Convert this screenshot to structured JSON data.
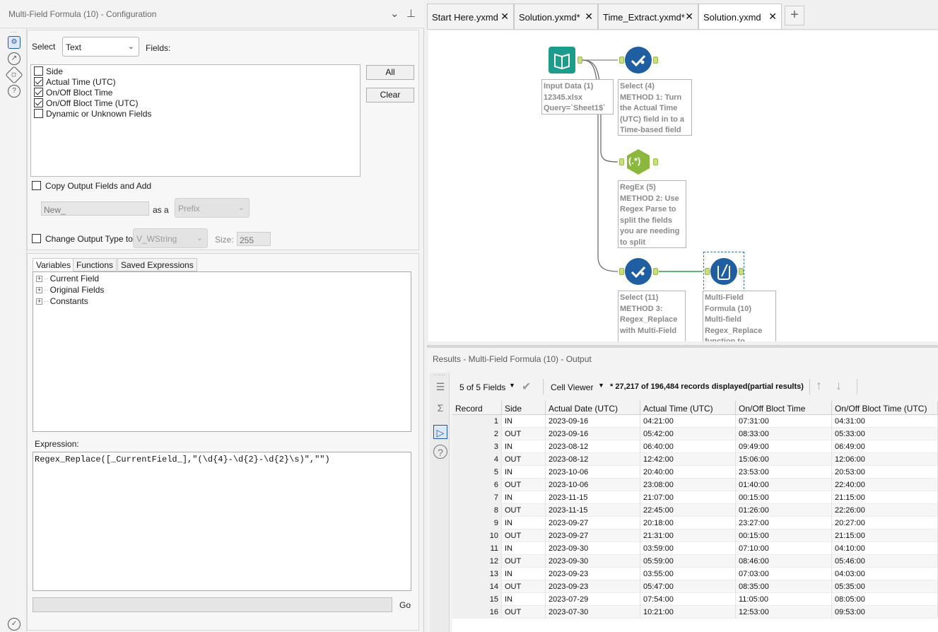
{
  "config_panel": {
    "title": "Multi-Field Formula (10) - Configuration",
    "select_label": "Select",
    "select_type_value": "Text",
    "fields_label": "Fields:",
    "fields": [
      {
        "label": "Side",
        "checked": false
      },
      {
        "label": "Actual Time (UTC)",
        "checked": true
      },
      {
        "label": "On/Off Bloct Time",
        "checked": true
      },
      {
        "label": "On/Off Bloct Time (UTC)",
        "checked": true
      },
      {
        "label": "Dynamic or Unknown Fields",
        "checked": false
      }
    ],
    "all_button": "All",
    "clear_button": "Clear",
    "copy_output_label": "Copy Output Fields and Add",
    "prefix_value": "New_",
    "as_a_label": "as a",
    "prefix_type": "Prefix",
    "change_output_label": "Change Output Type to",
    "output_type": "V_WString",
    "size_label": "Size:",
    "size_value": "255",
    "tabs": [
      "Variables",
      "Functions",
      "Saved Expressions"
    ],
    "variable_tree": [
      "Current Field",
      "Original Fields",
      "Constants"
    ],
    "expression_label": "Expression:",
    "expression": "Regex_Replace([_CurrentField_],\"(\\d{4}-\\d{2}-\\d{2}\\s)\",\"\")",
    "go_label": "Go"
  },
  "doc_tabs": [
    {
      "label": "Start Here.yxmd",
      "active": false
    },
    {
      "label": "Solution.yxmd*",
      "active": false
    },
    {
      "label": "Time_Extract.yxmd*",
      "active": false
    },
    {
      "label": "Solution.yxmd",
      "active": true
    }
  ],
  "workflow": {
    "input_node": "Input Data (1)\n12345.xlsx\nQuery=`Sheet1$`",
    "select4_node": "Select (4)\nMETHOD 1: Turn the Actual Time (UTC) field in to a Time-based field",
    "regex_node_icon": "(.*)",
    "regex_node": "RegEx (5)\nMETHOD 2: Use Regex Parse to split the fields you are needing to split",
    "select11_node": "Select (11)\nMETHOD 3: Regex_Replace with Multi-Field",
    "multifield_node": "Multi-Field Formula (10)\nMulti-field Regex_Replace function to"
  },
  "results": {
    "title": "Results - Multi-Field Formula (10) - Output",
    "fields_count": "5 of 5 Fields",
    "cell_viewer": "Cell Viewer",
    "records_info": "* 27,217 of 196,484 records displayed(partial results)",
    "columns": [
      "Record",
      "Side",
      "Actual Date (UTC)",
      "Actual Time (UTC)",
      "On/Off Bloct Time",
      "On/Off Bloct Time (UTC)"
    ],
    "rows": [
      [
        "1",
        "IN",
        "2023-09-16",
        "04:21:00",
        "07:31:00",
        "04:31:00"
      ],
      [
        "2",
        "OUT",
        "2023-09-16",
        "05:42:00",
        "08:33:00",
        "05:33:00"
      ],
      [
        "3",
        "IN",
        "2023-08-12",
        "06:40:00",
        "09:49:00",
        "06:49:00"
      ],
      [
        "4",
        "OUT",
        "2023-08-12",
        "12:42:00",
        "15:06:00",
        "12:06:00"
      ],
      [
        "5",
        "IN",
        "2023-10-06",
        "20:40:00",
        "23:53:00",
        "20:53:00"
      ],
      [
        "6",
        "OUT",
        "2023-10-06",
        "23:08:00",
        "01:40:00",
        "22:40:00"
      ],
      [
        "7",
        "IN",
        "2023-11-15",
        "21:07:00",
        "00:15:00",
        "21:15:00"
      ],
      [
        "8",
        "OUT",
        "2023-11-15",
        "22:45:00",
        "01:26:00",
        "22:26:00"
      ],
      [
        "9",
        "IN",
        "2023-09-27",
        "20:18:00",
        "23:27:00",
        "20:27:00"
      ],
      [
        "10",
        "OUT",
        "2023-09-27",
        "21:31:00",
        "00:15:00",
        "21:15:00"
      ],
      [
        "11",
        "IN",
        "2023-09-30",
        "03:59:00",
        "07:10:00",
        "04:10:00"
      ],
      [
        "12",
        "OUT",
        "2023-09-30",
        "05:59:00",
        "08:46:00",
        "05:46:00"
      ],
      [
        "13",
        "IN",
        "2023-09-23",
        "03:55:00",
        "07:03:00",
        "04:03:00"
      ],
      [
        "14",
        "OUT",
        "2023-09-23",
        "05:47:00",
        "08:35:00",
        "05:35:00"
      ],
      [
        "15",
        "IN",
        "2023-07-29",
        "07:54:00",
        "11:05:00",
        "08:05:00"
      ],
      [
        "16",
        "OUT",
        "2023-07-30",
        "10:21:00",
        "12:53:00",
        "09:53:00"
      ]
    ]
  }
}
